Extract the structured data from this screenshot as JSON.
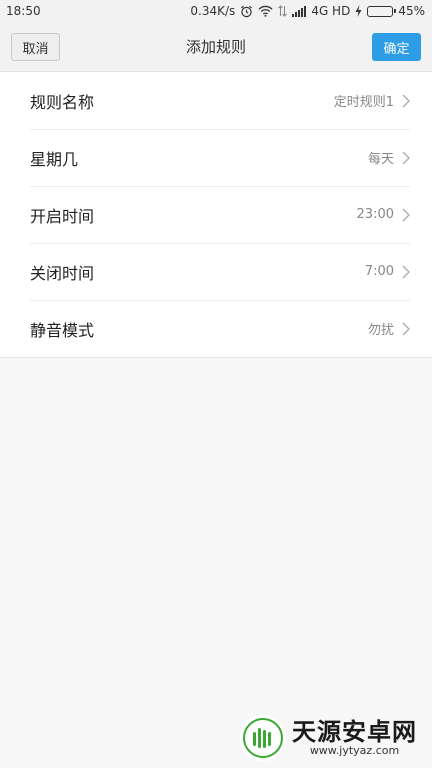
{
  "status_bar": {
    "time": "18:50",
    "speed": "0.34K/s",
    "network": "4G HD",
    "battery_percent": "45%",
    "battery_level": 0.45,
    "icons": [
      "alarm-icon",
      "wifi-icon",
      "data-arrows-icon",
      "signal-icon",
      "charging-icon",
      "battery-icon"
    ]
  },
  "header": {
    "title": "添加规则",
    "cancel_label": "取消",
    "confirm_label": "确定"
  },
  "rows": [
    {
      "label": "规则名称",
      "value": "定时规则1"
    },
    {
      "label": "星期几",
      "value": "每天"
    },
    {
      "label": "开启时间",
      "value": "23:00"
    },
    {
      "label": "关闭时间",
      "value": "7:00"
    },
    {
      "label": "静音模式",
      "value": "勿扰"
    }
  ],
  "watermark": {
    "main": "天源安卓网",
    "sub": "www.jytyaz.com"
  },
  "colors": {
    "accent": "#2d9ee5",
    "battery": "#2db34a",
    "watermark_green": "#3aa934"
  }
}
